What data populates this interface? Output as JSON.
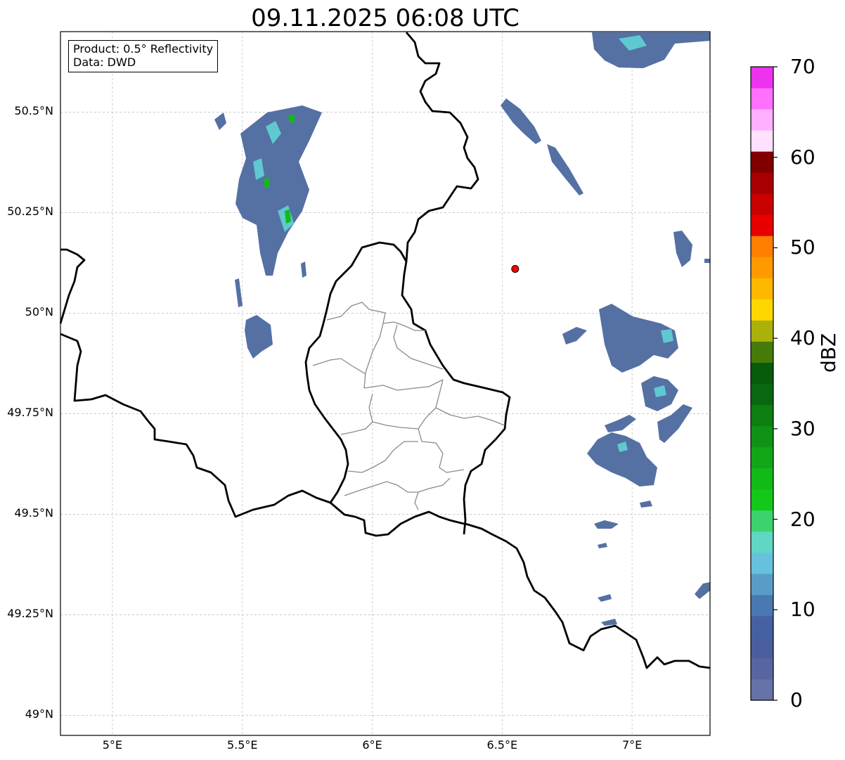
{
  "title": "09.11.2025 06:08 UTC",
  "info_box": {
    "product": "Product: 0.5° Reflectivity",
    "data": "Data: DWD"
  },
  "map": {
    "lon_range": [
      4.8,
      7.3
    ],
    "lat_range": [
      48.95,
      50.7
    ],
    "gridlines": true,
    "x_ticks": [
      {
        "value": 5.0,
        "label": "5°E"
      },
      {
        "value": 5.5,
        "label": "5.5°E"
      },
      {
        "value": 6.0,
        "label": "6°E"
      },
      {
        "value": 6.5,
        "label": "6.5°E"
      },
      {
        "value": 7.0,
        "label": "7°E"
      }
    ],
    "y_ticks": [
      {
        "value": 50.5,
        "label": "50.5°N"
      },
      {
        "value": 50.25,
        "label": "50.25°N"
      },
      {
        "value": 50.0,
        "label": "50°N"
      },
      {
        "value": 49.75,
        "label": "49.75°N"
      },
      {
        "value": 49.5,
        "label": "49.5°N"
      },
      {
        "value": 49.25,
        "label": "49.25°N"
      },
      {
        "value": 49.0,
        "label": "49°N"
      }
    ],
    "radar_site": {
      "lon": 6.55,
      "lat": 50.11,
      "color": "#ff0000"
    }
  },
  "colorbar": {
    "unit": "dBZ",
    "min": 0,
    "max": 70,
    "tick_labels": [
      "0",
      "10",
      "20",
      "30",
      "40",
      "50",
      "60",
      "70"
    ],
    "colors": [
      "#6573a6",
      "#5766a0",
      "#4a5e9e",
      "#4561a2",
      "#4a78b0",
      "#5a9cc8",
      "#66c2dc",
      "#60d6c4",
      "#3cd36e",
      "#14c81a",
      "#12ba18",
      "#11a617",
      "#0f9215",
      "#0c7e12",
      "#09680f",
      "#075b0b",
      "#467a09",
      "#aab20a",
      "#ffd700",
      "#ffb800",
      "#ff9900",
      "#ff7f00",
      "#e80000",
      "#c80000",
      "#a80000",
      "#800000",
      "#ffe0ff",
      "#ffb0ff",
      "#ff70ff",
      "#ee33ee"
    ]
  }
}
